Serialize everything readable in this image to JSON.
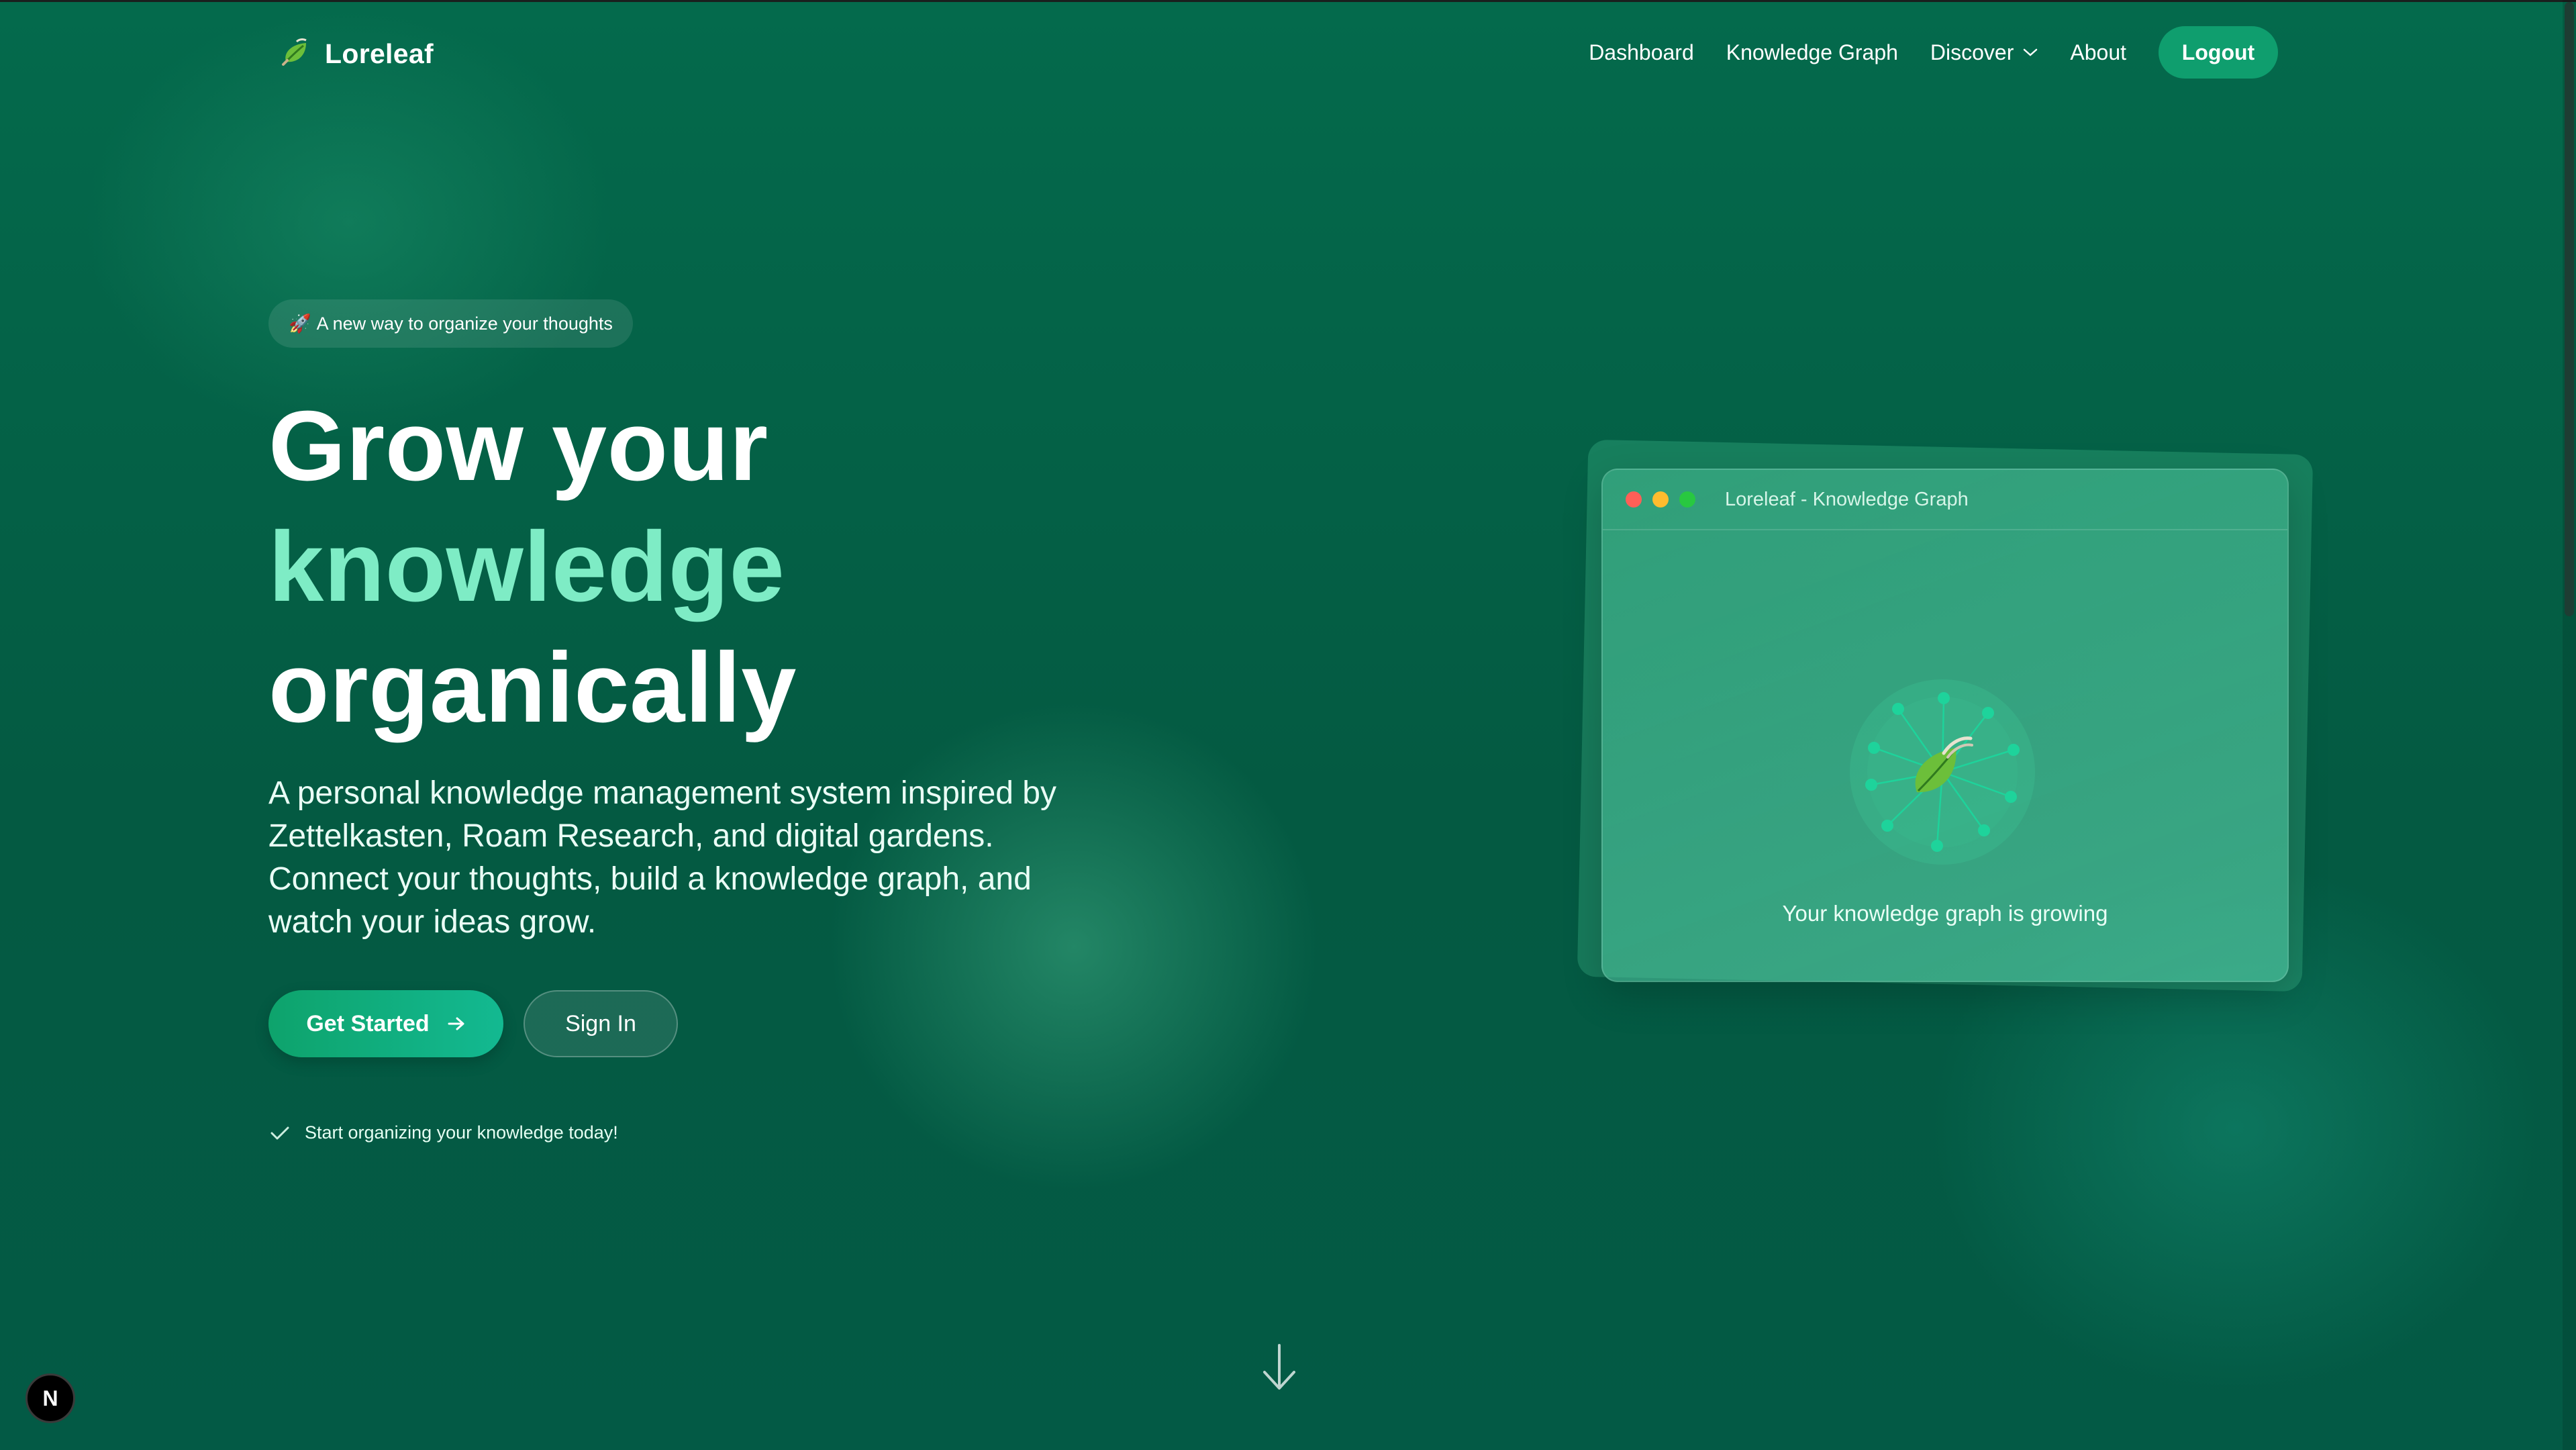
{
  "brand": {
    "name": "Loreleaf",
    "logo_icon": "leaf-icon"
  },
  "nav": {
    "items": [
      {
        "label": "Dashboard"
      },
      {
        "label": "Knowledge Graph"
      },
      {
        "label": "Discover",
        "icon": "chevron-down-icon"
      },
      {
        "label": "About"
      }
    ],
    "logout_label": "Logout"
  },
  "hero": {
    "badge": {
      "icon": "rocket-icon",
      "text": "A new way to organize your thoughts"
    },
    "headline": {
      "line1": "Grow your",
      "line2": "knowledge",
      "line3": "organically"
    },
    "description": "A personal knowledge management system inspired by Zettelkasten, Roam Research, and digital gardens. Connect your thoughts, build a knowledge graph, and watch your ideas grow.",
    "primary_button": {
      "label": "Get Started",
      "icon": "arrow-right-icon"
    },
    "secondary_button": {
      "label": "Sign In"
    },
    "note": {
      "icon": "check-icon",
      "text": "Start organizing your knowledge today!"
    }
  },
  "preview_window": {
    "title": "Loreleaf - Knowledge Graph",
    "caption": "Your knowledge graph is growing",
    "traffic_lights": [
      "#ff5f57",
      "#febc2e",
      "#28c840"
    ],
    "graph_icon": "leaf-icon"
  },
  "scroll_indicator": {
    "icon": "arrow-down-icon"
  },
  "dev_badge": {
    "label": "N"
  },
  "colors": {
    "accent": "#7eecc5",
    "button_green": "#0f9e6e",
    "background": "#045a44"
  }
}
